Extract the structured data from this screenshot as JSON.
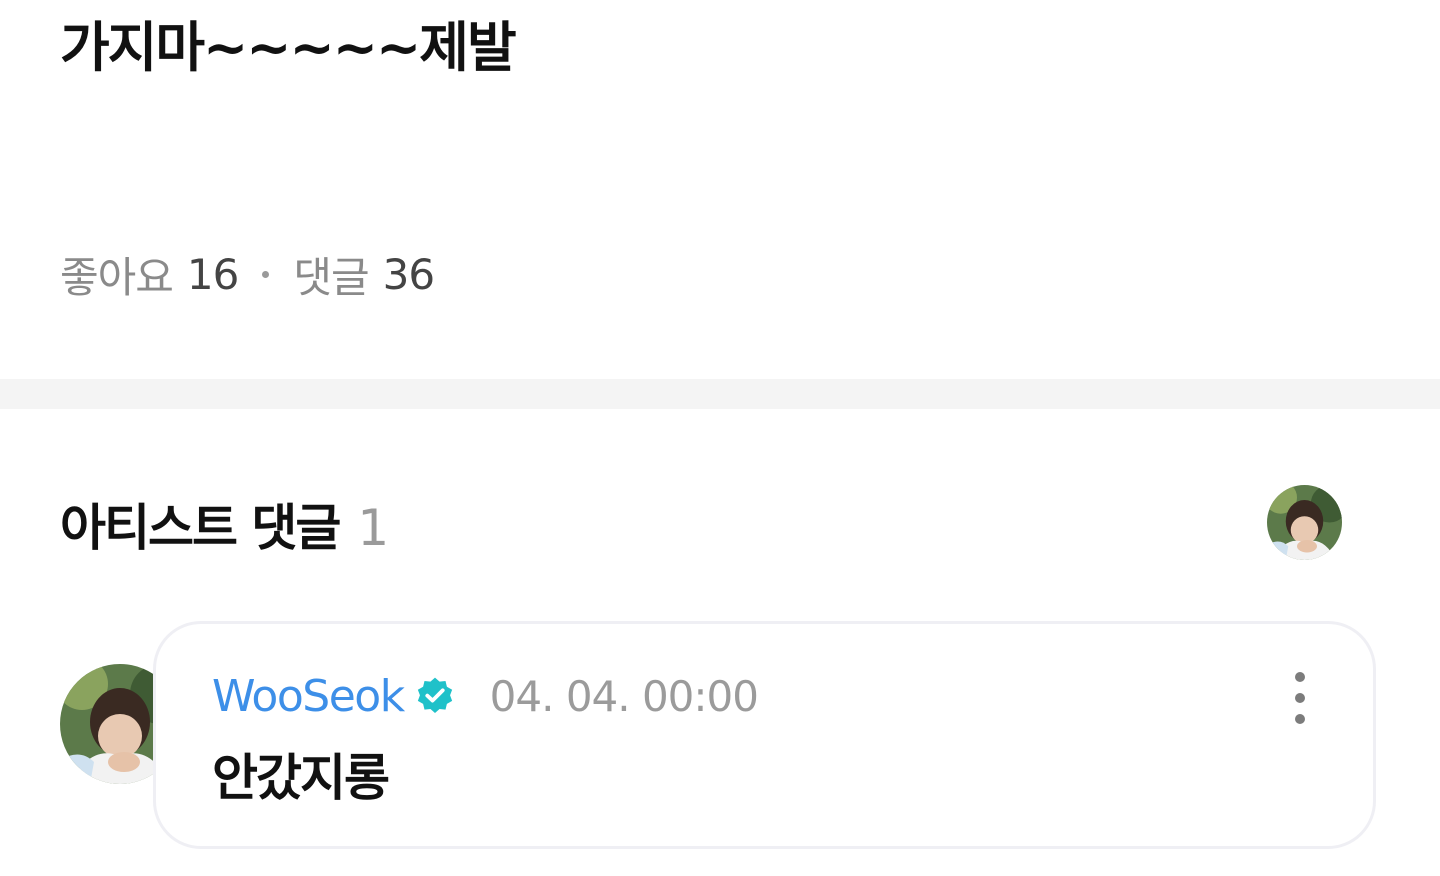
{
  "post": {
    "text": "가지마~~~~~제발"
  },
  "stats": {
    "likes_label": "좋아요",
    "likes_count": "16",
    "comments_label": "댓글",
    "comments_count": "36"
  },
  "artist_comments": {
    "title": "아티스트 댓글",
    "count": "1",
    "avatar_icon": "artist-profile-photo"
  },
  "comment": {
    "author": "WooSeok",
    "verified_icon": "verified-badge-icon",
    "timestamp": "04. 04. 00:00",
    "text": "안갔지롱",
    "more_icon": "more-vertical-icon"
  },
  "colors": {
    "author": "#3d8fe8",
    "verified": "#1fc1c9",
    "muted": "#9b9b9b",
    "divider": "#f4f4f4"
  }
}
